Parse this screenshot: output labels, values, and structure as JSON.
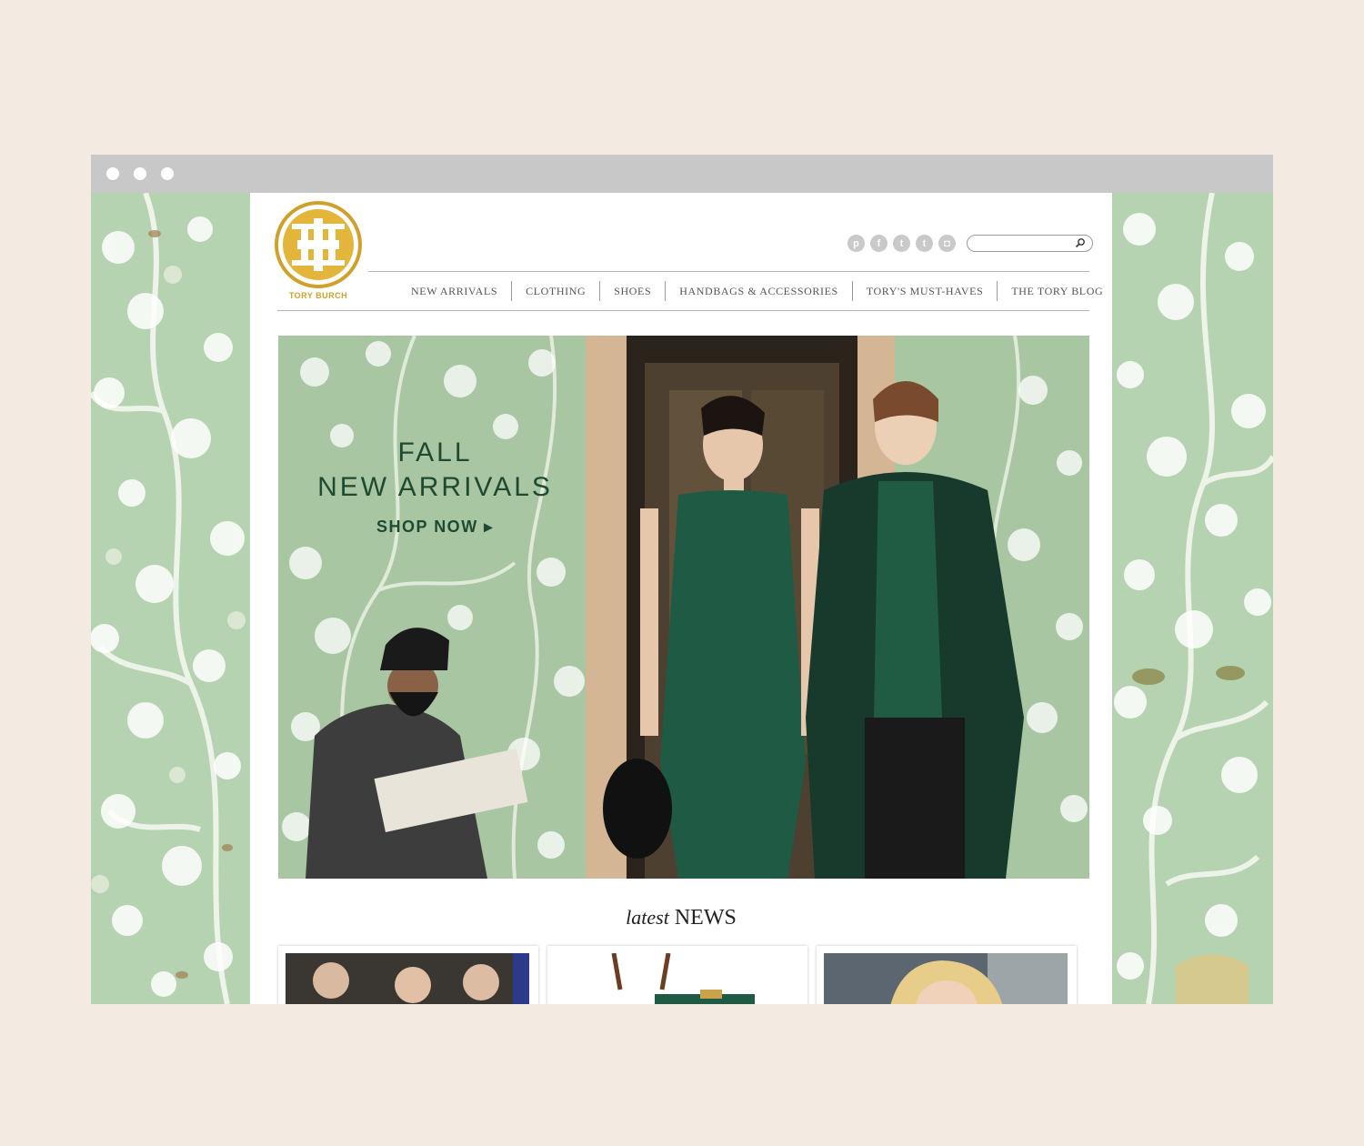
{
  "brand": {
    "name": "TORY BURCH",
    "gold": "#d0a12a"
  },
  "social": [
    {
      "name": "pinterest-icon",
      "glyph": "p"
    },
    {
      "name": "facebook-icon",
      "glyph": "f"
    },
    {
      "name": "twitter-icon",
      "glyph": "t"
    },
    {
      "name": "tumblr-icon",
      "glyph": "t"
    },
    {
      "name": "instagram-icon",
      "glyph": "◘"
    }
  ],
  "search": {
    "placeholder": ""
  },
  "nav": {
    "items": [
      {
        "label": "NEW ARRIVALS"
      },
      {
        "label": "CLOTHING"
      },
      {
        "label": "SHOES"
      },
      {
        "label": "HANDBAGS & ACCESSORIES"
      },
      {
        "label": "TORY'S MUST-HAVES"
      },
      {
        "label": "THE TORY BLOG"
      }
    ]
  },
  "hero": {
    "title_line1": "FALL",
    "title_line2": "NEW ARRIVALS",
    "cta": "SHOP NOW",
    "cta_arrow": "▸"
  },
  "news": {
    "heading_italic": "latest",
    "heading_caps": "NEWS"
  },
  "colors": {
    "page_bg": "#f3ebe1",
    "titlebar": "#c8c8c8",
    "wallpaper_green": "#b7d4b2",
    "hero_text": "#1e4a32",
    "nav_text": "#555555"
  }
}
